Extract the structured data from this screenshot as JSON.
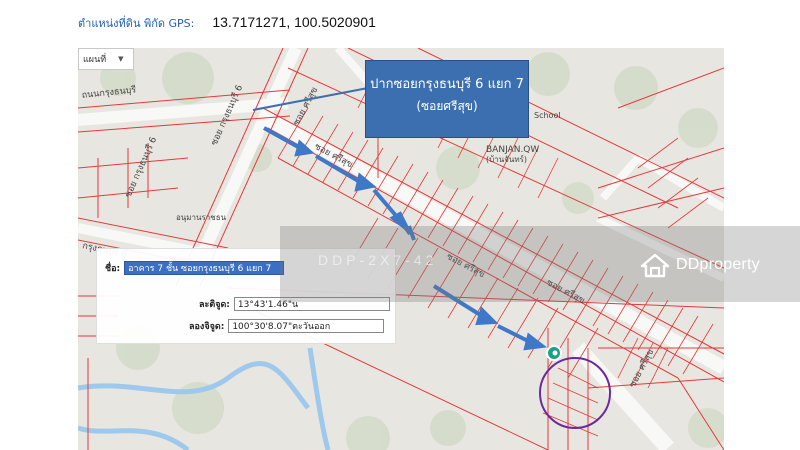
{
  "header": {
    "gps_label": "ตำแหน่งที่ดิน พิกัด GPS:",
    "gps_value": "13.7171271, 100.5020901"
  },
  "map": {
    "type_select": "แผนที่",
    "callout": {
      "line1": "ปากซอยกรุงธนบุรี 6 แยก 7",
      "line2": "(ซอยศรีสุข)"
    },
    "road_labels": {
      "road_a1": "ถนนกรุงธนบุรี",
      "road_a2": "ซอย กรุงธนบุรี 6",
      "road_a3": "ซอย กรุงธนบุรี 6",
      "road_a4": "กรุงธนบุรี 6",
      "road_a5": "ถนนกรุงธนบุรี",
      "soi_sri_1": "ซอย ศรีสุข",
      "soi_sri_2": "ซอย ศรีสุข",
      "soi_sri_3": "ซอย ศรีสุข",
      "soi_sri_4": "ซอย ศรีสุข",
      "soi_sri_5": "ซอย ศรีสุข",
      "place_banjan": "BANJAN.QW",
      "place_banjan_th": "(บ้านจันทร์)",
      "place_school": "School",
      "place_anuman": "อนุมานราชธน"
    },
    "info_panel": {
      "name_label": "ชื่อ:",
      "name_value": "อาคาร 7 ชั้น ซอยกรุงธนบุรี 6 แยก 7",
      "lat_label": "ละติจูด:",
      "lat_value": "13°43'1.46\"น",
      "lon_label": "ลองจิจูด:",
      "lon_value": "100°30'8.07\"ตะวันออก"
    },
    "colors": {
      "parcel_line": "#e23b3b",
      "road_fill": "#f7f7f5",
      "water": "#9ec9ec",
      "callout_bg": "#3c6fb0",
      "route_arrow": "#3f78c6",
      "target_circle": "#6a2a9e",
      "marker": "#1aa08a"
    }
  },
  "watermark": {
    "brand": "DDproperty",
    "code": "DDP-2X7-42"
  }
}
